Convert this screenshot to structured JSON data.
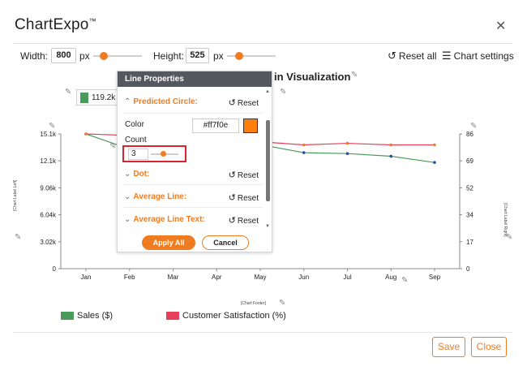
{
  "app": {
    "title": "ChartExpo",
    "trademark": "™",
    "close_glyph": "✕"
  },
  "toolbar": {
    "width_label": "Width:",
    "width_value": "800",
    "width_unit": "px",
    "height_label": "Height:",
    "height_value": "525",
    "height_unit": "px",
    "width_slider_level": 0.22,
    "height_slider_level": 0.25,
    "reset_all_label": "Reset all",
    "chart_settings_label": "Chart settings",
    "reset_icon": "undo-icon",
    "settings_icon": "sliders-icon"
  },
  "chart": {
    "title_visible": "in Visualization",
    "tooltip_value": "119.2k",
    "footer_label": "[Chart Footer]",
    "y_label_left": "[Chart Label Left]",
    "y_label_right": "[Chart Label Right]"
  },
  "chart_data": {
    "type": "line",
    "x": [
      "Jan",
      "Feb",
      "Mar",
      "Apr",
      "May",
      "Jun",
      "Jul",
      "Aug",
      "Sep"
    ],
    "y_left_ticks": [
      "0",
      "3.02k",
      "6.04k",
      "9.06k",
      "12.1k",
      "15.1k"
    ],
    "y_right_ticks": [
      "0",
      "17",
      "34",
      "52",
      "69",
      "86"
    ],
    "ylim_left": [
      0,
      15100
    ],
    "ylim_right": [
      0,
      86
    ],
    "series": [
      {
        "name": "Sales ($)",
        "color": "#4a9a5a",
        "axis": "left",
        "values": [
          15100,
          13400,
          null,
          null,
          13900,
          13000,
          12900,
          12600,
          11900
        ],
        "point_color": "#1f4fb5"
      },
      {
        "name": "Customer Satisfaction (%)",
        "color": "#e8405a",
        "axis": "right",
        "values": [
          86,
          85,
          null,
          null,
          81,
          79,
          80,
          79,
          79
        ],
        "point_color": "#f07c22"
      }
    ],
    "grid": false,
    "legend_position": "bottom"
  },
  "panel": {
    "header": "Line Properties",
    "sections": [
      {
        "label": "Predicted Circle:",
        "reset": "Reset",
        "expanded": true
      },
      {
        "label": "Dot:",
        "reset": "Reset",
        "expanded": false
      },
      {
        "label": "Average Line:",
        "reset": "Reset",
        "expanded": false
      },
      {
        "label": "Average Line Text:",
        "reset": "Reset",
        "expanded": false
      }
    ],
    "color_label": "Color",
    "color_hex": "#ff7f0e",
    "count_label": "Count",
    "count_value": "3",
    "count_slider_level": 0.45,
    "apply_label": "Apply All",
    "cancel_label": "Cancel"
  },
  "legend": [
    {
      "label": "Sales ($)",
      "color": "#4a9a5a"
    },
    {
      "label": "Customer Satisfaction (%)",
      "color": "#e8405a"
    }
  ],
  "footer_buttons": {
    "save": "Save",
    "close": "Close"
  }
}
